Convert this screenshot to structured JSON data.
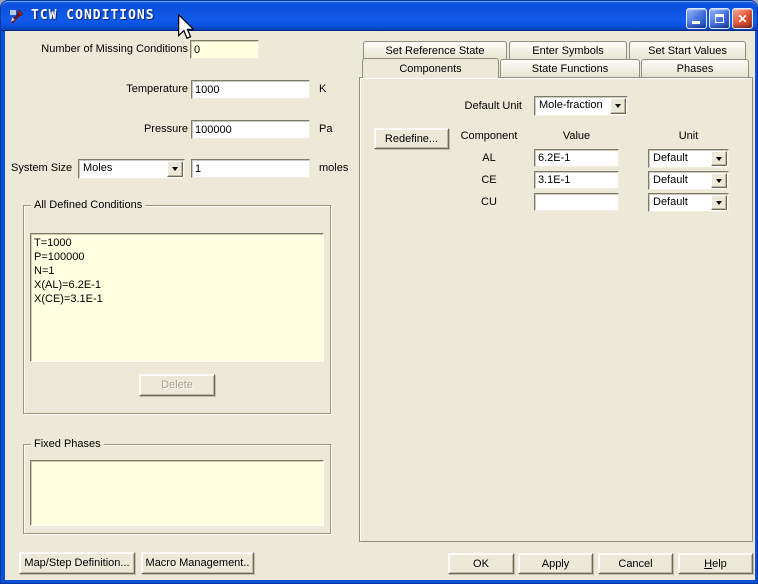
{
  "window": {
    "title": "TCW CONDITIONS"
  },
  "icons": {
    "close": "✕"
  },
  "colors": {
    "titlebar_blue": "#0C54E6",
    "dialog_bg": "#ECE9D8",
    "field_cream": "#FFFFE1",
    "close_button_red": "#D85432",
    "disabled_text": "#A5A08C"
  },
  "left": {
    "missing": {
      "label": "Number of Missing Conditions",
      "value": "0"
    },
    "temperature": {
      "label": "Temperature",
      "value": "1000",
      "unit": "K"
    },
    "pressure": {
      "label": "Pressure",
      "value": "100000",
      "unit": "Pa"
    },
    "system_size": {
      "label": "System Size",
      "selected": "Moles",
      "value": "1",
      "unit": "moles"
    },
    "defined_conditions": {
      "label": "All Defined Conditions",
      "items": [
        "T=1000",
        "P=100000",
        "N=1",
        "X(AL)=6.2E-1",
        "X(CE)=3.1E-1"
      ],
      "delete_label": "Delete"
    },
    "fixed_phases": {
      "label": "Fixed Phases"
    }
  },
  "footer_left": {
    "map_step": "Map/Step Definition...",
    "macro": "Macro Management.."
  },
  "tabs": {
    "row1": [
      "Set Reference State",
      "Enter Symbols",
      "Set Start Values"
    ],
    "row2": [
      "Components",
      "State Functions",
      "Phases"
    ],
    "active": "Components"
  },
  "components_tab": {
    "default_unit_label": "Default Unit",
    "default_unit_value": "Mole-fraction",
    "redefine_label": "Redefine...",
    "headers": {
      "component": "Component",
      "value": "Value",
      "unit": "Unit"
    },
    "rows": [
      {
        "component": "AL",
        "value": "6.2E-1",
        "unit": "Default"
      },
      {
        "component": "CE",
        "value": "3.1E-1",
        "unit": "Default"
      },
      {
        "component": "CU",
        "value": "",
        "unit": "Default"
      }
    ]
  },
  "footer_right": {
    "ok": "OK",
    "apply": "Apply",
    "cancel": "Cancel",
    "help": "Help"
  }
}
